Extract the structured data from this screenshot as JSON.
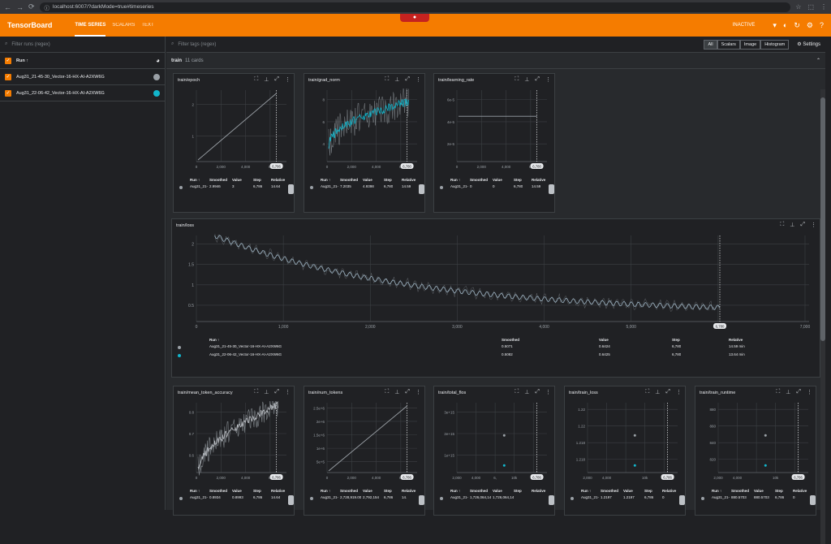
{
  "browser": {
    "url": "localhost:6007/?darkMode=true#timeseries"
  },
  "app": {
    "logo": "TensorBoard",
    "tabs": [
      "TIME SERIES",
      "SCALARS",
      "TEXT"
    ],
    "status": "INACTIVE"
  },
  "runs": {
    "filter_placeholder": "Filter runs (regex)",
    "header": "Run ↑",
    "items": [
      {
        "name": "Aug31_21-45-30_Vector-16-HX-AI-A2XW6G",
        "color": "#9aa0a6"
      },
      {
        "name": "Aug31_22-06-42_Vector-16-HX-AI-A2XW6G",
        "color": "#12b5cb"
      }
    ]
  },
  "main": {
    "filter_placeholder": "Filter tags (regex)",
    "seg": [
      "All",
      "Scalars",
      "Image",
      "Histogram"
    ],
    "settings": "Settings",
    "group": "train",
    "group_count": "11 cards"
  },
  "table_headers": {
    "run": "Run ↑",
    "smoothed": "Smoothed",
    "value": "Value",
    "step": "Step",
    "relative": "Relative"
  },
  "cards": {
    "epoch": {
      "title": "train/epoch",
      "yticks": [
        "2",
        "1"
      ],
      "xticks": [
        "0",
        "2,000",
        "4,000",
        "6,"
      ],
      "step_badge": "6,786",
      "row": {
        "run": "Aug31_21-45-30_Vector-16-HX-AI-",
        "smoothed": "2.9946",
        "value": "3",
        "step": "6,786",
        "relative": "14.64"
      }
    },
    "grad_norm": {
      "title": "train/grad_norm",
      "yticks": [
        "8",
        "6",
        "4"
      ],
      "xticks": [
        "0",
        "2,000",
        "4,000",
        "6,"
      ],
      "step_badge": "6,780",
      "row": {
        "run": "Aug31_21-45-30_Vector-16-HX-AI-",
        "smoothed": "7.2035",
        "value": "4.9398",
        "step": "6,780",
        "relative": "14.59"
      }
    },
    "learning_rate": {
      "title": "train/learning_rate",
      "yticks": [
        "6e-5",
        "4e-5",
        "2e-5"
      ],
      "xticks": [
        "0",
        "2,000",
        "4,000",
        "6,"
      ],
      "step_badge": "6,780",
      "row": {
        "run": "Aug31_21-45-30_Vector-16-HX-AI-",
        "smoothed": "0",
        "value": "0",
        "step": "6,780",
        "relative": "14.59"
      }
    },
    "loss": {
      "title": "train/loss",
      "yticks": [
        "2",
        "1.5",
        "1",
        "0.5"
      ],
      "xticks": [
        "0",
        "1,000",
        "2,000",
        "3,000",
        "4,000",
        "5,000",
        "6,000",
        "7,000"
      ],
      "step_badge": "6,780",
      "rows": [
        {
          "run": "Aug31_21-45-30_Vector-16-HX-AI-A2XW6G",
          "smoothed": "0.5071",
          "value": "0.6424",
          "step": "6,780",
          "relative": "14.59 min"
        },
        {
          "run": "Aug31_22-06-42_Vector-16-HX-AI-A2XW6G",
          "smoothed": "0.5082",
          "value": "0.6425",
          "step": "6,780",
          "relative": "13.64 min"
        }
      ]
    },
    "mean_token_accuracy": {
      "title": "train/mean_token_accuracy",
      "yticks": [
        "0.8",
        "0.7",
        "0.6"
      ],
      "xticks": [
        "0",
        "2,000",
        "4,000",
        "6,"
      ],
      "step_badge": "6,786",
      "row": {
        "run": "Aug31_21-45-30_Vector-",
        "smoothed": "0.8934",
        "value": "0.8993",
        "step": "6,786",
        "relative": "14.64"
      }
    },
    "num_tokens": {
      "title": "train/num_tokens",
      "yticks": [
        "2.5e+6",
        "2e+6",
        "1.5e+6",
        "1e+6",
        "5e+5"
      ],
      "xticks": [
        "0",
        "2,000",
        "4,000",
        "6,"
      ],
      "step_badge": "6,786",
      "row": {
        "run": "Aug31_21-45-30_Vector-",
        "smoothed": "2,728,919.0047",
        "value": "2,792,154",
        "step": "6,786",
        "relative": "14."
      }
    },
    "total_flos": {
      "title": "train/total_flos",
      "yticks": [
        "3e+15",
        "2e+15",
        "1e+15"
      ],
      "xticks": [
        "2,000",
        "4,000",
        "6,",
        "10k",
        "12k"
      ],
      "step_badge": "6,786",
      "row": {
        "run": "Aug31_21-45-30_Vector-",
        "smoothed": "1,726,064,141,271,040",
        "value": "1,726,064,141,2",
        "step": "",
        "relative": ""
      }
    },
    "train_loss": {
      "title": "train/train_loss",
      "yticks": [
        "1.22",
        "1.22",
        "1.218",
        "1.218"
      ],
      "xticks": [
        "2,000",
        "4,000",
        "",
        "10k",
        "12k"
      ],
      "step_badge": "6,786",
      "row": {
        "run": "Aug31_21-45-30_Vector-",
        "smoothed": "1.2197",
        "value": "1.2197",
        "step": "6,786",
        "relative": "0"
      }
    },
    "train_runtime": {
      "title": "train/train_runtime",
      "yticks": [
        "880",
        "860",
        "840",
        "820"
      ],
      "xticks": [
        "2,000",
        "4,000",
        "",
        "10k",
        "12k"
      ],
      "step_badge": "6,786",
      "row": {
        "run": "Aug31_21-45-30_Vector-",
        "smoothed": "880.5703",
        "value": "880.5703",
        "step": "6,786",
        "relative": "0"
      }
    }
  },
  "colors": {
    "accent": "#f57c00",
    "run1": "#9aa0a6",
    "run2": "#12b5cb"
  }
}
